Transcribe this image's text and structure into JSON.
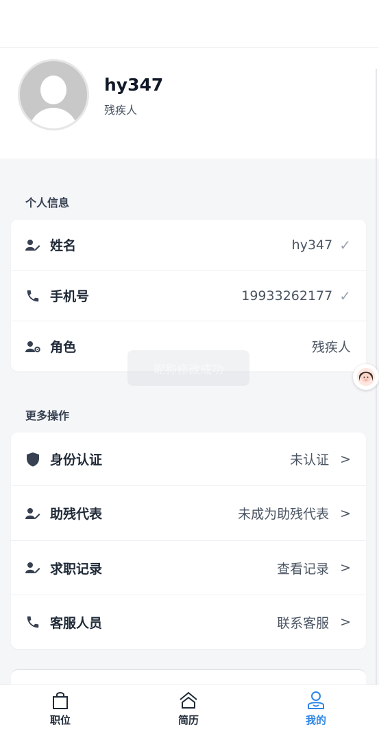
{
  "profile": {
    "username": "hy347",
    "role_tag": "残疾人"
  },
  "personal_info": {
    "title": "个人信息",
    "rows": [
      {
        "label": "姓名",
        "value": "hy347",
        "icon": "user-edit-icon",
        "verified": true
      },
      {
        "label": "手机号",
        "value": "19933262177",
        "icon": "phone-icon",
        "verified": true
      },
      {
        "label": "角色",
        "value": "残疾人",
        "icon": "user-gear-icon",
        "verified": false
      }
    ]
  },
  "more_actions": {
    "title": "更多操作",
    "rows": [
      {
        "label": "身份认证",
        "value": "未认证",
        "icon": "shield-icon"
      },
      {
        "label": "助残代表",
        "value": "未成为助残代表",
        "icon": "user-edit-icon"
      },
      {
        "label": "求职记录",
        "value": "查看记录",
        "icon": "user-edit-icon"
      },
      {
        "label": "客服人员",
        "value": "联系客服",
        "icon": "phone-icon"
      }
    ]
  },
  "toast": {
    "message": "昵称修改成功"
  },
  "tabs": [
    {
      "label": "职位",
      "icon": "bag-icon",
      "active": false
    },
    {
      "label": "简历",
      "icon": "home-icon",
      "active": false
    },
    {
      "label": "我的",
      "icon": "person-icon",
      "active": true
    }
  ],
  "colors": {
    "accent": "#2f86e6",
    "background": "#f5f6f8",
    "icon": "#374151"
  }
}
